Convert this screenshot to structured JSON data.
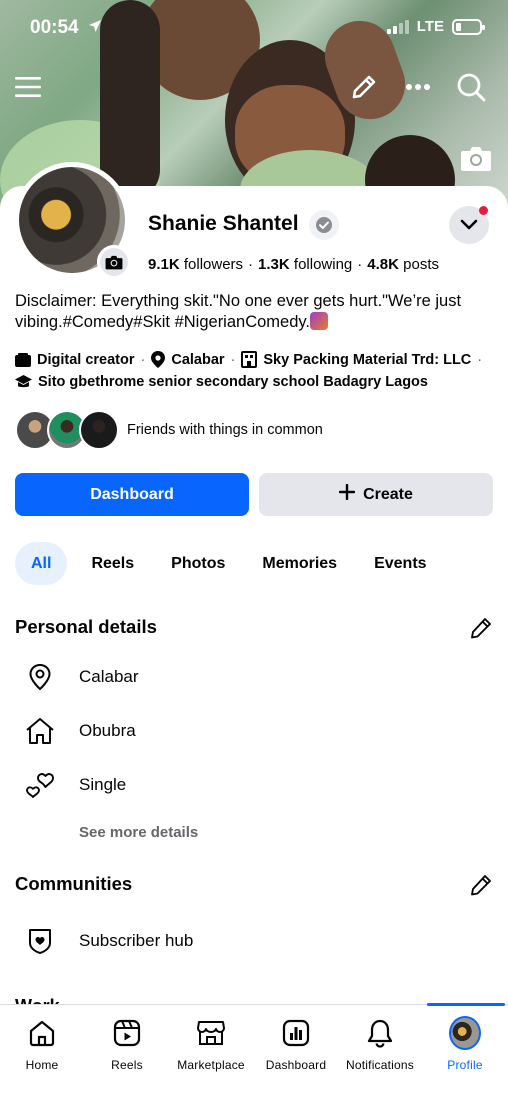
{
  "status_bar": {
    "time": "00:54",
    "carrier": "LTE"
  },
  "header": {
    "icons": [
      "menu-icon",
      "edit-icon",
      "more-icon",
      "search-icon"
    ]
  },
  "profile": {
    "name": "Shanie Shantel",
    "followers_count": "9.1K",
    "followers_label": "followers",
    "following_count": "1.3K",
    "following_label": "following",
    "posts_count": "4.8K",
    "posts_label": "posts",
    "bio": "Disclaimer: Everything skit.\"No one ever gets hurt.\"We’re just vibing.#Comedy#Skit #NigerianComedy.",
    "meta_line1": [
      {
        "icon": "category-icon",
        "text": "Digital creator"
      },
      {
        "icon": "location-pin-icon",
        "text": "Calabar"
      },
      {
        "icon": "workplace-icon",
        "text": "Sky Packing Material Trd: LLC"
      }
    ],
    "meta_line2": [
      {
        "icon": "education-icon",
        "text": "Sito gbethrome senior secondary school Badagry Lagos"
      }
    ],
    "friends_text": "Friends with things in common"
  },
  "actions": {
    "dashboard_label": "Dashboard",
    "create_label": "Create"
  },
  "tabs": [
    {
      "label": "All",
      "active": true
    },
    {
      "label": "Reels",
      "active": false
    },
    {
      "label": "Photos",
      "active": false
    },
    {
      "label": "Memories",
      "active": false
    },
    {
      "label": "Events",
      "active": false
    }
  ],
  "personal_details": {
    "title": "Personal details",
    "items": [
      {
        "icon": "location-pin-icon",
        "label": "Calabar"
      },
      {
        "icon": "home-icon",
        "label": "Obubra"
      },
      {
        "icon": "hearts-icon",
        "label": "Single"
      }
    ],
    "see_more": "See more details"
  },
  "communities": {
    "title": "Communities",
    "items": [
      {
        "icon": "shield-heart-icon",
        "label": "Subscriber hub"
      }
    ]
  },
  "next_section_partial": "Work",
  "bottom_nav": [
    {
      "label": "Home",
      "icon": "home-icon",
      "active": false
    },
    {
      "label": "Reels",
      "icon": "reels-icon",
      "active": false
    },
    {
      "label": "Marketplace",
      "icon": "marketplace-icon",
      "active": false
    },
    {
      "label": "Dashboard",
      "icon": "dashboard-icon",
      "active": false
    },
    {
      "label": "Notifications",
      "icon": "bell-icon",
      "active": false
    },
    {
      "label": "Profile",
      "icon": "profile-avatar",
      "active": true
    }
  ],
  "colors": {
    "accent": "#0866ff",
    "badge_red": "#e41e3f",
    "secondary_button": "#e4e6eb",
    "muted_text": "#65676b"
  }
}
